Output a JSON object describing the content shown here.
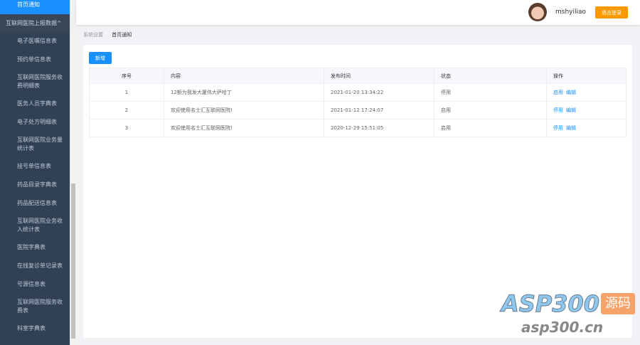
{
  "sidebar": {
    "active": "首页通知",
    "group": "互联网医院上报数据^",
    "items": [
      "电子医嘱信息表",
      "预约单信息表",
      "互联网医院服务收费明细表",
      "医务人员字典表",
      "电子处方明细表",
      "互联网医院业务量统计表",
      "挂号单信息表",
      "药品目录字典表",
      "药品配送信息表",
      "互联网医院业务收入统计表",
      "医院字典表",
      "在线复诊单记录表",
      "号源信息表",
      "互联网医院服务收费表",
      "科室字典表"
    ]
  },
  "header": {
    "username": "mshyiliao",
    "logout": "退出登录"
  },
  "breadcrumb": [
    "系统设置",
    "首页通知"
  ],
  "toolbar": {
    "add": "新增"
  },
  "table": {
    "headers": [
      "序号",
      "内容",
      "发布时间",
      "状态",
      "操作"
    ],
    "rows": [
      {
        "no": "1",
        "content": "12额为我发大厦伟大萨哈丁",
        "time": "2021-01-20 13:34:22",
        "status": "停用",
        "toggle": "启用",
        "edit": "编辑"
      },
      {
        "no": "2",
        "content": "欢迎使用名士汇互联网医院!",
        "time": "2021-01-12 17:24:07",
        "status": "启用",
        "toggle": "停用",
        "edit": "编辑"
      },
      {
        "no": "3",
        "content": "欢迎使用名士汇互联网医院!",
        "time": "2020-12-29 15:51:05",
        "status": "启用",
        "toggle": "停用",
        "edit": "编辑"
      }
    ]
  },
  "watermark": {
    "brand": "ASP300",
    "tag": "源码",
    "url": "asp300.cn"
  }
}
